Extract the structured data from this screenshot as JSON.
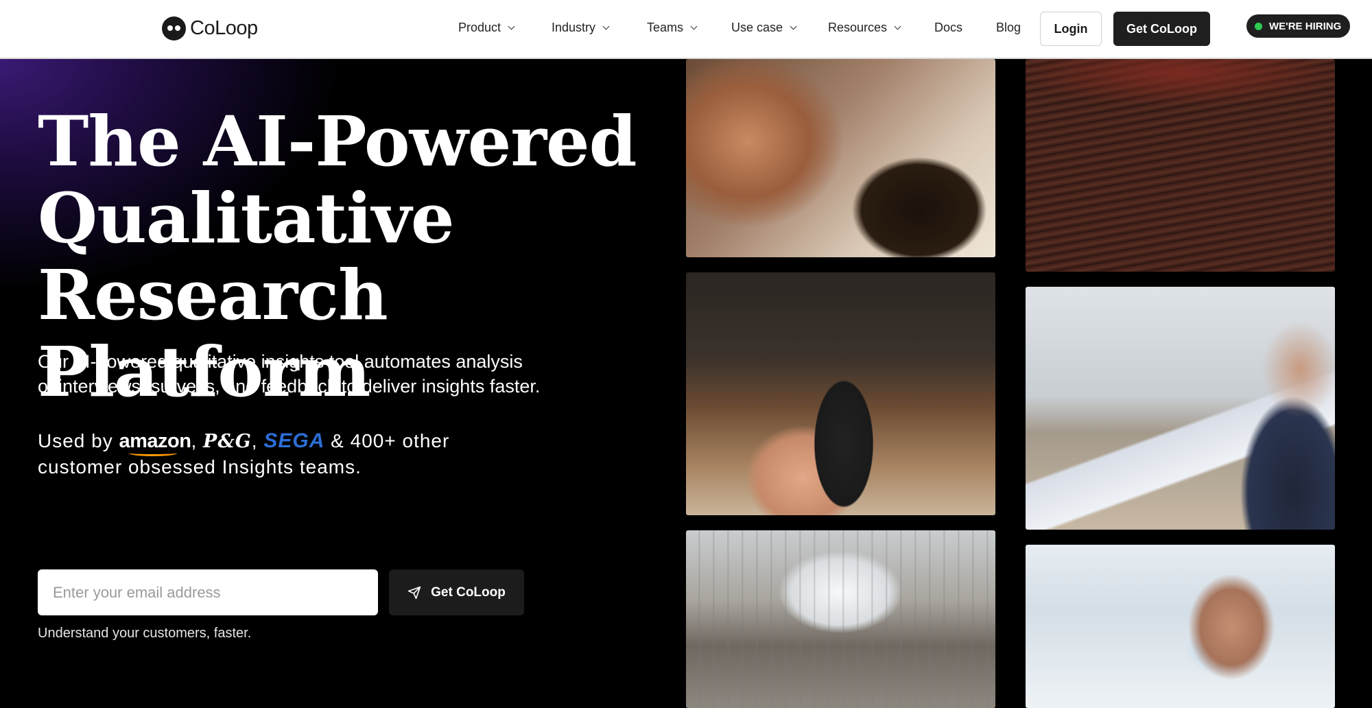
{
  "nav": {
    "logo_text": "CoLoop",
    "items": [
      {
        "label": "Product",
        "has_dropdown": true
      },
      {
        "label": "Industry",
        "has_dropdown": true
      },
      {
        "label": "Teams",
        "has_dropdown": true
      },
      {
        "label": "Use case",
        "has_dropdown": true
      },
      {
        "label": "Resources",
        "has_dropdown": true
      },
      {
        "label": "Docs",
        "has_dropdown": false
      },
      {
        "label": "Blog",
        "has_dropdown": false
      }
    ],
    "login_label": "Login",
    "cta_label": "Get CoLoop",
    "hiring_label": "WE'RE HIRING",
    "hiring_dot_color": "#2ecc52"
  },
  "hero": {
    "headline_lines": [
      "The AI-Powered",
      "Qualitative",
      "Research Platform"
    ],
    "subtitle_line1": "Our AI-powered qualitative insights tool automates analysis",
    "subtitle_line2": "of interviews, surveys, and feedback to deliver insights faster.",
    "used_by_prefix": "Used by",
    "brands": [
      "amazon",
      "P&G",
      "SEGA"
    ],
    "used_by_suffix": "& 400+ other",
    "used_by_line2": "customer obsessed Insights teams.",
    "email_placeholder": "Enter your email address",
    "cta_label": "Get CoLoop",
    "tagline": "Understand your customers, faster."
  },
  "photos": [
    {
      "name": "coffee-photo"
    },
    {
      "name": "theater-audience-photo"
    },
    {
      "name": "tv-remote-photo"
    },
    {
      "name": "laptop-analytics-photo"
    },
    {
      "name": "shopping-mall-photo"
    },
    {
      "name": "lab-microscope-photo"
    }
  ],
  "colors": {
    "accent_purple": "#3a1a74",
    "amazon_orange": "#ff9900",
    "sega_blue": "#2b6ed6"
  }
}
